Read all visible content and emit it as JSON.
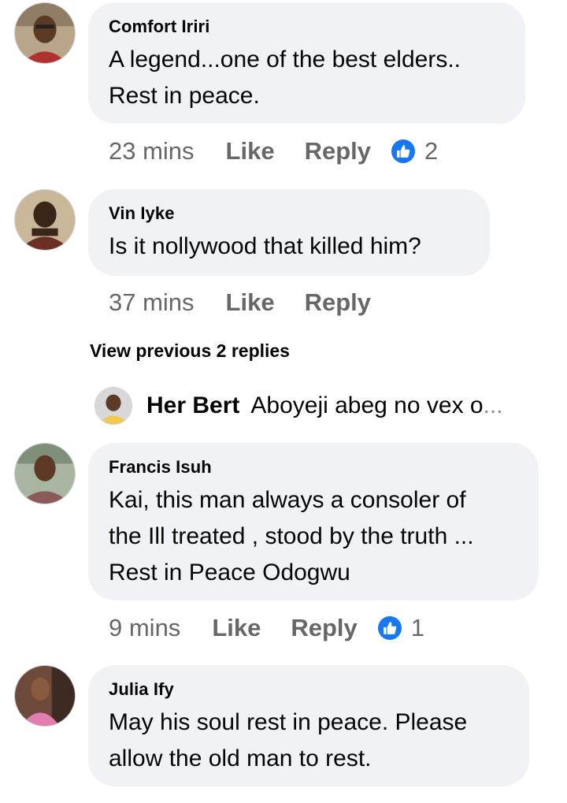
{
  "comments": [
    {
      "author": "Comfort Iriri",
      "text": "A legend...one of the best elders..\nRest in peace.",
      "time": "23 mins",
      "like_label": "Like",
      "reply_label": "Reply",
      "reaction_icon": "like-icon",
      "reaction_count": "2"
    },
    {
      "author": "Vin Iyke",
      "text": "Is it nollywood that killed him?",
      "time": "37 mins",
      "like_label": "Like",
      "reply_label": "Reply"
    },
    {
      "author": "Francis Isuh",
      "text": "Kai,  this man always a consoler of\nthe Ill treated , stood by the truth ...\nRest in Peace Odogwu",
      "time": "9 mins",
      "like_label": "Like",
      "reply_label": "Reply",
      "reaction_icon": "like-icon",
      "reaction_count": "1"
    },
    {
      "author": "Julia Ify",
      "text": "May his soul rest in peace. Please\nallow the old man to rest."
    }
  ],
  "view_previous_replies": "View previous 2 replies",
  "reply_preview": {
    "author": "Her Bert",
    "text": "Aboyeji abeg no vex o",
    "ellipsis": "..."
  },
  "colors": {
    "bubble_bg": "#f0f2f5",
    "meta_text": "#65676b",
    "like_blue": "#1877f2"
  }
}
